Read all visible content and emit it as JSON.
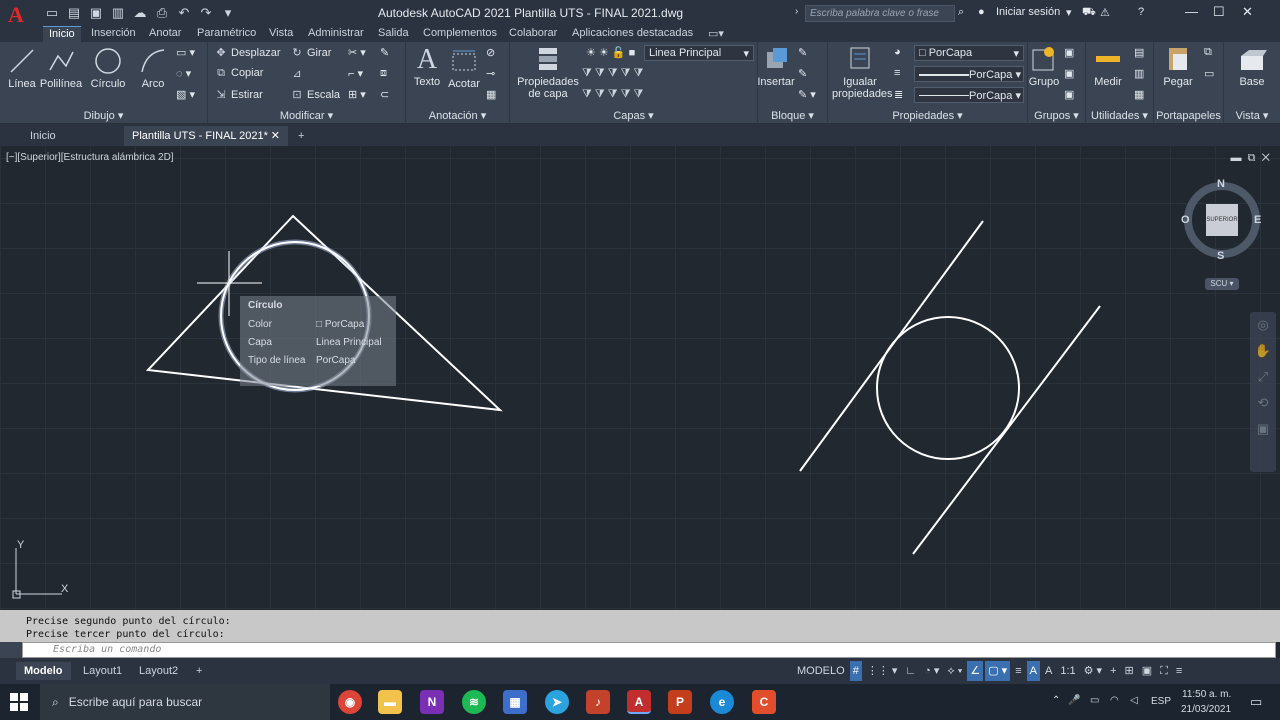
{
  "window": {
    "title": "Autodesk AutoCAD 2021    Plantilla UTS - FINAL 2021.dwg",
    "search_placeholder": "Escriba palabra clave o frase",
    "sign_in": "Iniciar sesión"
  },
  "ribbon_tabs": [
    "Inicio",
    "Inserción",
    "Anotar",
    "Paramétrico",
    "Vista",
    "Administrar",
    "Salida",
    "Complementos",
    "Colaborar",
    "Aplicaciones destacadas"
  ],
  "panels": {
    "dibujo": {
      "title": "Dibujo ▾",
      "linea": "Línea",
      "polilinea": "Polilínea",
      "circulo": "Círculo",
      "arco": "Arco"
    },
    "modificar": {
      "title": "Modificar ▾",
      "desplazar": "Desplazar",
      "girar": "Girar",
      "copiar": "Copiar",
      "estirar": "Estirar",
      "escala": "Escala"
    },
    "anotacion": {
      "title": "Anotación ▾",
      "texto": "Texto",
      "acotar": "Acotar"
    },
    "capas": {
      "title": "Capas ▾",
      "propiedades_capa": "Propiedades de capa",
      "layer_combo": "Linea Principal"
    },
    "bloque": {
      "title": "Bloque ▾",
      "insertar": "Insertar"
    },
    "propiedades": {
      "title": "Propiedades ▾",
      "igualar": "Igualar propiedades",
      "color": "PorCapa",
      "linetype": "PorCapa",
      "lineweight": "PorCapa"
    },
    "grupos": {
      "title": "Grupos ▾",
      "grupo": "Grupo"
    },
    "utilidades": {
      "title": "Utilidades ▾",
      "medir": "Medir"
    },
    "portapapeles": {
      "title": "Portapapeles",
      "pegar": "Pegar"
    },
    "vista": {
      "title": "Vista ▾",
      "base": "Base"
    }
  },
  "file_tabs": {
    "home": "Inicio",
    "active": "Plantilla UTS - FINAL 2021*"
  },
  "viewport": {
    "label": "[−][Superior][Estructura alámbrica 2D]"
  },
  "tooltip": {
    "title": "Círculo",
    "rows": [
      {
        "k": "Color",
        "v": "□ PorCapa"
      },
      {
        "k": "Capa",
        "v": "Linea Principal"
      },
      {
        "k": "Tipo de línea",
        "v": "PorCapa"
      }
    ]
  },
  "viewcube": {
    "n": "N",
    "s": "S",
    "e": "E",
    "o": "O",
    "face": "SUPERIOR",
    "ucs": "SCU ▾"
  },
  "ucs_icon": {
    "x": "X",
    "y": "Y"
  },
  "command": {
    "history": [
      "Precise segundo punto del círculo:",
      "Precise tercer punto del círculo:"
    ],
    "placeholder": "Escriba un comando"
  },
  "layout_tabs": [
    "Modelo",
    "Layout1",
    "Layout2"
  ],
  "status": {
    "model": "MODELO",
    "scale": "1:1"
  },
  "taskbar": {
    "search": "Escribe aquí para buscar",
    "time": "11:50 a. m.",
    "date": "21/03/2021",
    "lang": "ESP"
  },
  "colors": {
    "accent": "#3a6fb0",
    "autocad_red": "#e4282a",
    "canvas": "#212830"
  }
}
